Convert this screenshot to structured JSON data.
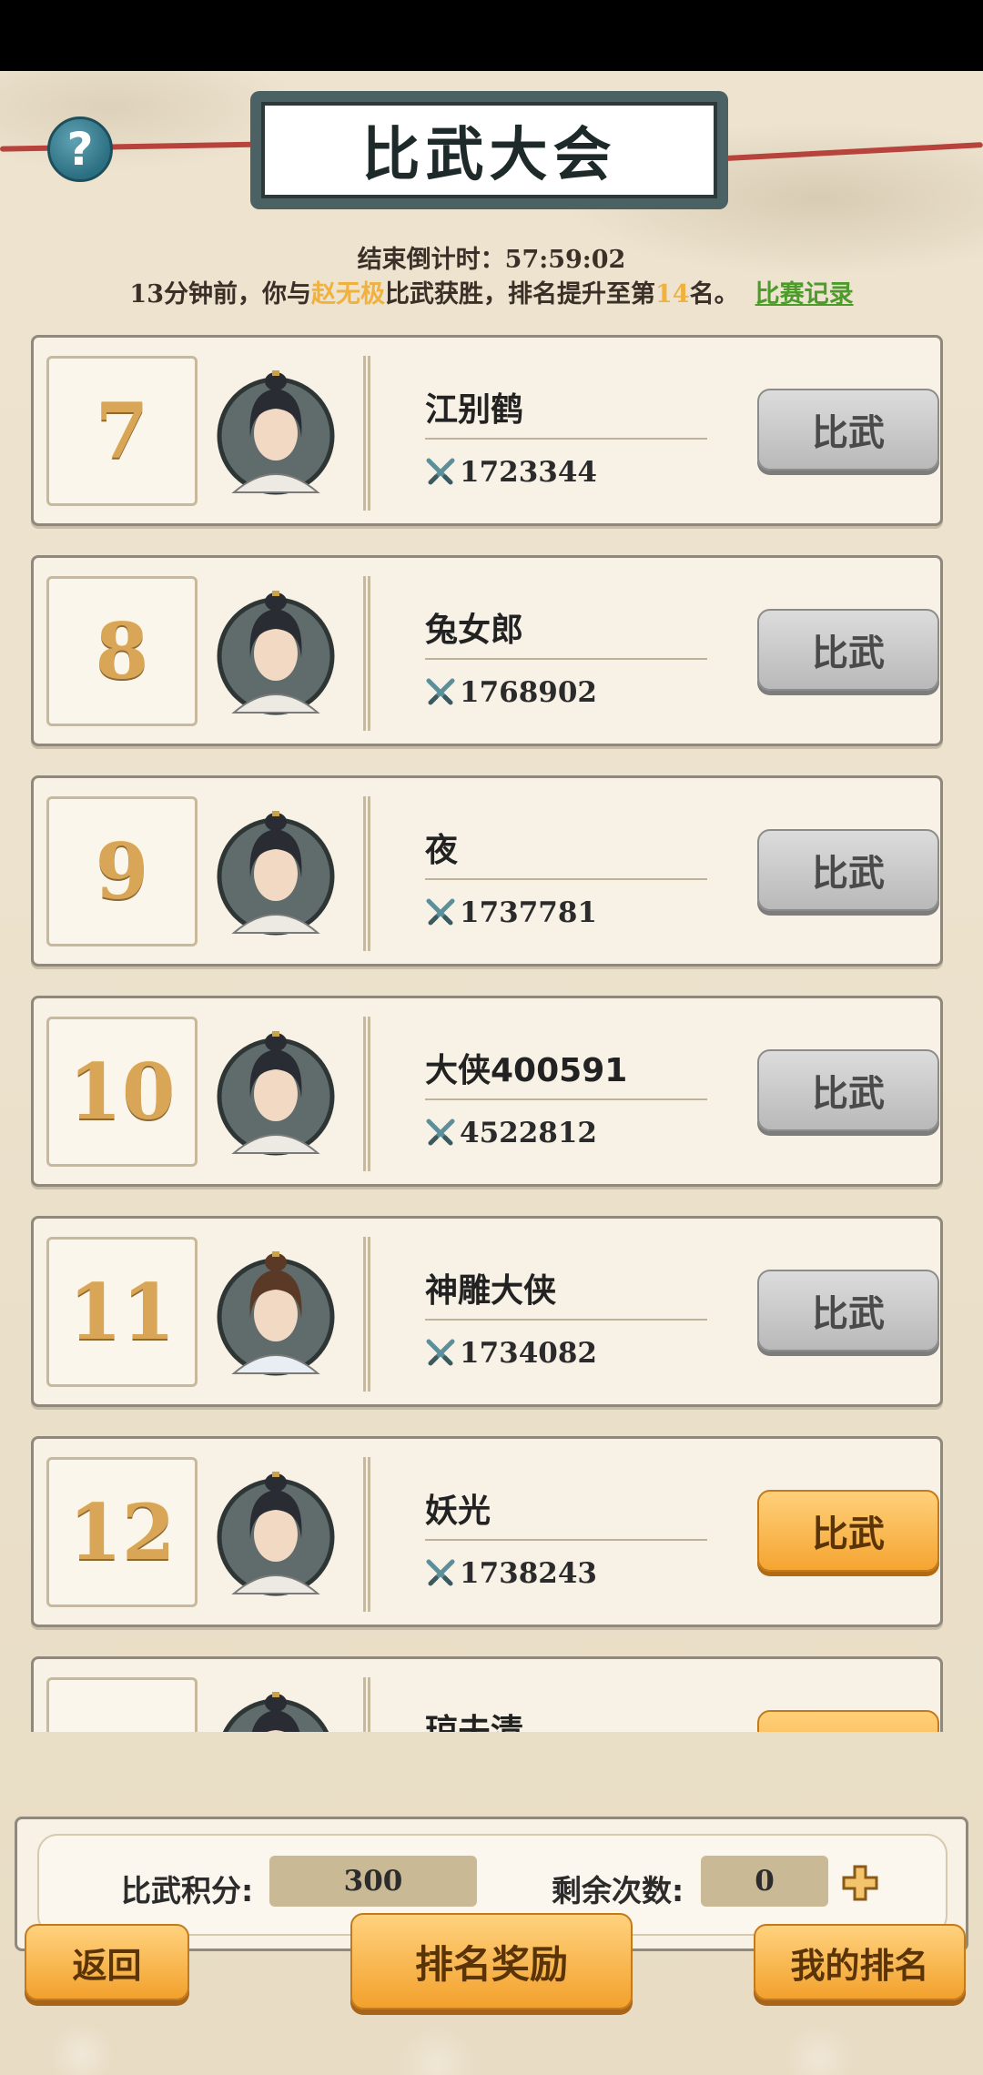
{
  "header": {
    "title": "比武大会",
    "help_icon": "question-icon",
    "countdown": "结束倒计时：57:59:02",
    "news": {
      "prefix": "13分钟前，你与",
      "opponent": "赵无极",
      "middle": "比武获胜，排名提升至第",
      "rank": "14",
      "suffix": "名。",
      "record_link": "比赛记录"
    }
  },
  "list": {
    "rows": [
      {
        "rank": "7",
        "name": "江别鹤",
        "power": "1723344",
        "button": "比武",
        "active": false,
        "avatar": "black-hair"
      },
      {
        "rank": "8",
        "name": "兔女郎",
        "power": "1768902",
        "button": "比武",
        "active": false,
        "avatar": "black-hair"
      },
      {
        "rank": "9",
        "name": "夜",
        "power": "1737781",
        "button": "比武",
        "active": false,
        "avatar": "black-hair"
      },
      {
        "rank": "10",
        "name": "大侠400591",
        "power": "4522812",
        "button": "比武",
        "active": false,
        "avatar": "black-hair"
      },
      {
        "rank": "11",
        "name": "神雕大侠",
        "power": "1734082",
        "button": "比武",
        "active": false,
        "avatar": "brown-hair"
      },
      {
        "rank": "12",
        "name": "妖光",
        "power": "1738243",
        "button": "比武",
        "active": true,
        "avatar": "black-hair"
      },
      {
        "rank": "",
        "name": "琼夫清",
        "power": "",
        "button": "",
        "active": true,
        "avatar": "black-hair"
      }
    ]
  },
  "stats": {
    "score_label": "比武积分:",
    "score_value": "300",
    "remaining_label": "剩余次数:",
    "remaining_value": "0",
    "plus_icon": "plus-icon"
  },
  "nav": {
    "back": "返回",
    "rewards": "排名奖励",
    "my_rank": "我的排名"
  },
  "colors": {
    "accent_orange": "#f5a531",
    "highlight": "#f0b13e",
    "link_green": "#4c9b2b",
    "rank_gold": "#d9a556"
  }
}
